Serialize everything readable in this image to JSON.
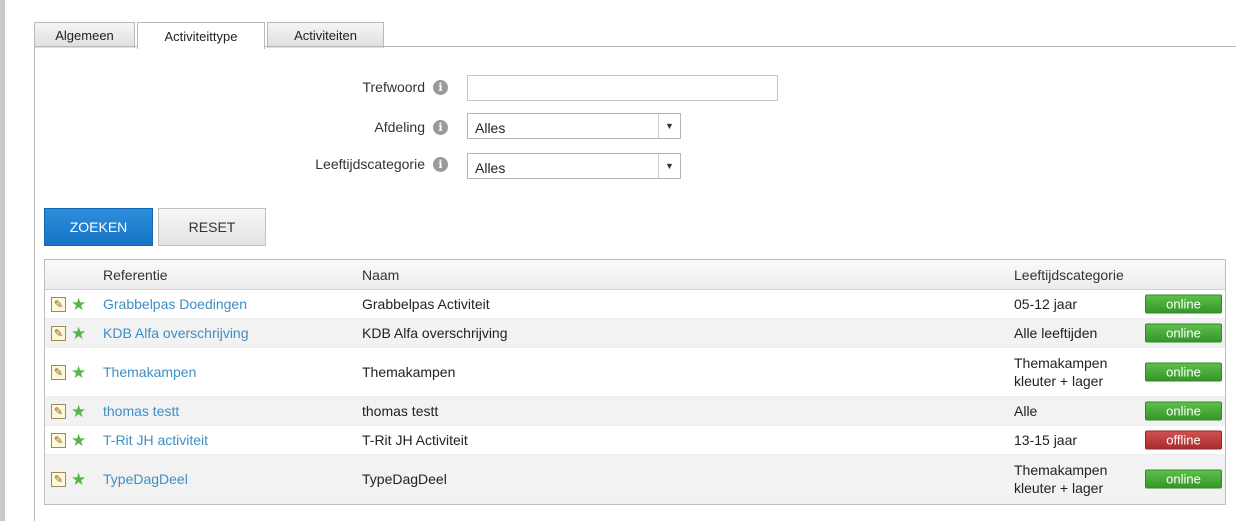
{
  "tabs": [
    {
      "label": "Algemeen",
      "active": false
    },
    {
      "label": "Activiteittype",
      "active": true
    },
    {
      "label": "Activiteiten",
      "active": false
    }
  ],
  "form": {
    "trefwoord_label": "Trefwoord",
    "trefwoord_value": "",
    "afdeling_label": "Afdeling",
    "afdeling_value": "Alles",
    "leeftijd_label": "Leeftijdscategorie",
    "leeftijd_value": "Alles"
  },
  "buttons": {
    "search": "ZOEKEN",
    "reset": "RESET"
  },
  "table": {
    "headers": {
      "referentie": "Referentie",
      "naam": "Naam",
      "leeftijd": "Leeftijdscategorie"
    },
    "rows": [
      {
        "referentie": "Grabbelpas Doedingen",
        "naam": "Grabbelpas Activiteit",
        "leeftijd_1": "05-12 jaar",
        "leeftijd_2": "",
        "status": "online"
      },
      {
        "referentie": "KDB Alfa overschrijving",
        "naam": "KDB Alfa overschrijving",
        "leeftijd_1": "Alle leeftijden",
        "leeftijd_2": "",
        "status": "online"
      },
      {
        "referentie": "Themakampen",
        "naam": "Themakampen",
        "leeftijd_1": "Themakampen",
        "leeftijd_2": "kleuter + lager",
        "status": "online"
      },
      {
        "referentie": "thomas testt",
        "naam": "thomas testt",
        "leeftijd_1": "Alle",
        "leeftijd_2": "",
        "status": "online"
      },
      {
        "referentie": "T-Rit JH activiteit",
        "naam": "T-Rit JH Activiteit",
        "leeftijd_1": "13-15 jaar",
        "leeftijd_2": "",
        "status": "offline"
      },
      {
        "referentie": "TypeDagDeel",
        "naam": "TypeDagDeel",
        "leeftijd_1": "Themakampen",
        "leeftijd_2": "kleuter + lager",
        "status": "online"
      }
    ]
  },
  "icons": {
    "edit": "pencil-edit-icon",
    "favorite": "star-icon",
    "info": "info-icon",
    "dropdown": "chevron-down-icon"
  },
  "colors": {
    "link": "#3d8fc6",
    "primary_button": "#1772c4",
    "online": "#36962a",
    "offline": "#a92d2d"
  }
}
